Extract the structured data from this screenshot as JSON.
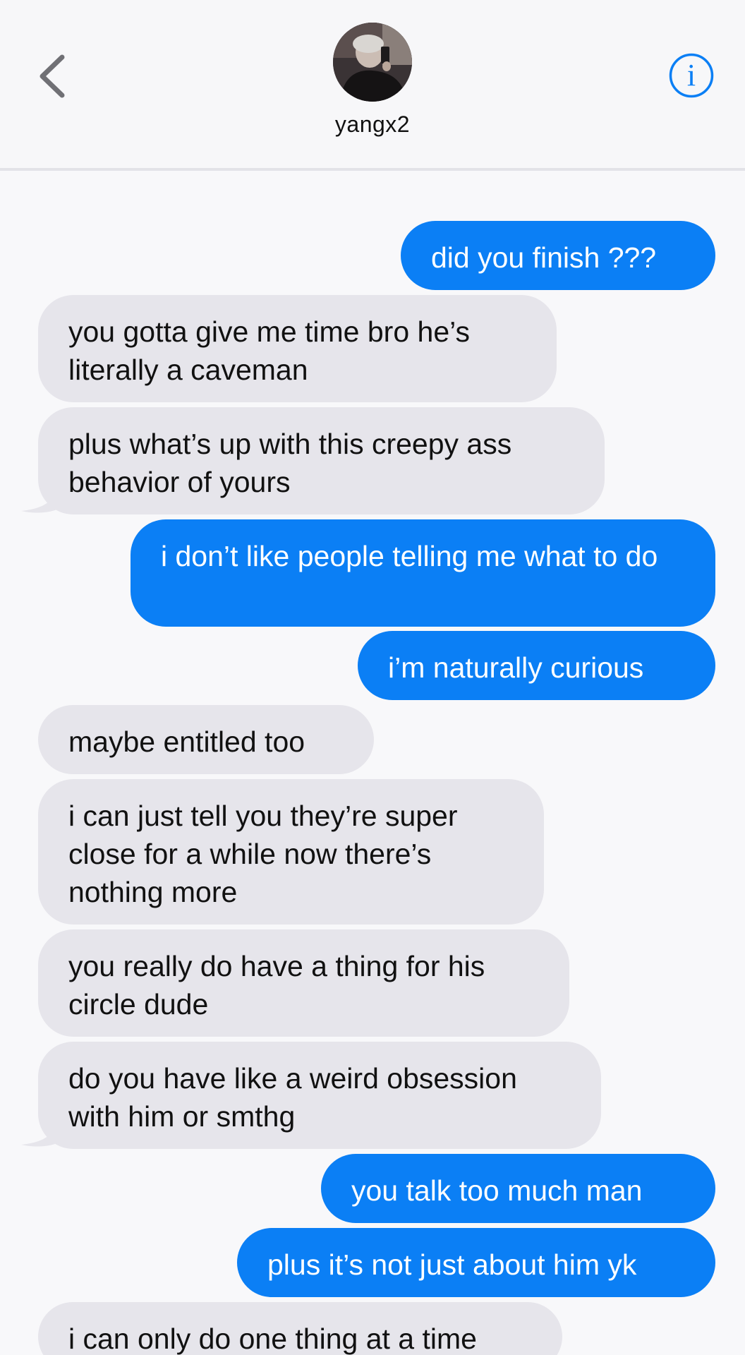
{
  "header": {
    "contact_name": "yangx2",
    "back_icon": "chevron-left-icon",
    "info_icon": "info-icon",
    "accent_color": "#0b7ff5"
  },
  "messages": [
    {
      "direction": "sent",
      "text": "did you finish ???"
    },
    {
      "direction": "received",
      "text": "you gotta give me time bro he’s literally a caveman"
    },
    {
      "direction": "received",
      "text": "plus what’s up with this creepy ass behavior of yours"
    },
    {
      "direction": "sent",
      "text": "i don’t like people telling me what to do"
    },
    {
      "direction": "sent",
      "text": "i’m naturally curious"
    },
    {
      "direction": "received",
      "text": "maybe entitled too"
    },
    {
      "direction": "received",
      "text": "i can just tell you they’re super close for a while now there’s nothing more"
    },
    {
      "direction": "received",
      "text": "you really do have a thing for his circle dude"
    },
    {
      "direction": "received",
      "text": "do you have like a weird obsession with him or smthg"
    },
    {
      "direction": "sent",
      "text": "you talk too much man"
    },
    {
      "direction": "sent",
      "text": "plus it’s not just about him yk"
    },
    {
      "direction": "received",
      "text": "i can only do one thing at a time"
    }
  ],
  "colors": {
    "sent_bubble": "#0b7ff5",
    "received_bubble": "#e6e5eb",
    "background": "#f8f8fa"
  }
}
